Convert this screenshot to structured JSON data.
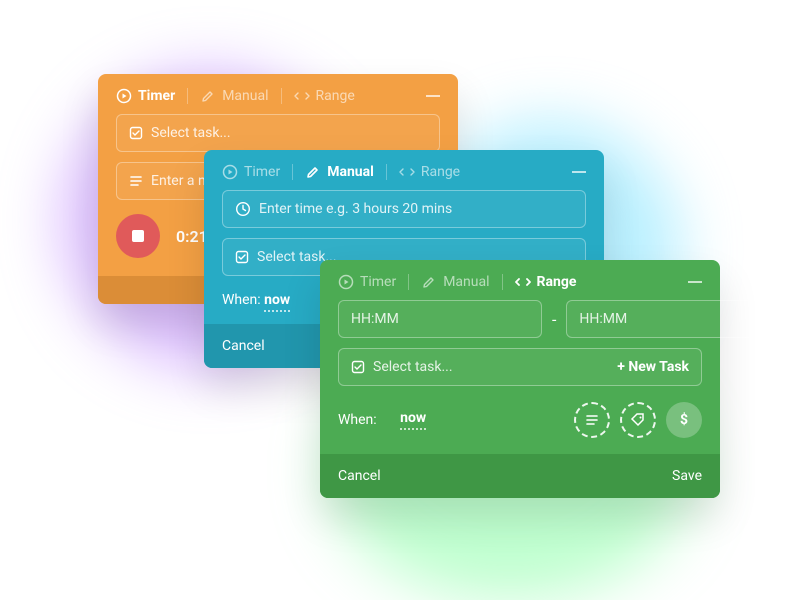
{
  "orange": {
    "tabs": {
      "timer": "Timer",
      "manual": "Manual",
      "range": "Range"
    },
    "select_task_placeholder": "Select task...",
    "note_placeholder": "Enter a note...",
    "elapsed": "0:21:00"
  },
  "teal": {
    "tabs": {
      "timer": "Timer",
      "manual": "Manual",
      "range": "Range"
    },
    "time_placeholder": "Enter time e.g. 3 hours 20 mins",
    "select_task_placeholder": "Select task...",
    "when_label": "When:",
    "when_value": "now",
    "cancel": "Cancel"
  },
  "green": {
    "tabs": {
      "timer": "Timer",
      "manual": "Manual",
      "range": "Range"
    },
    "hhmm": "HH:MM",
    "dash": "-",
    "select_task_placeholder": "Select task...",
    "new_task": "+ New Task",
    "when_label": "When:",
    "when_value": "now",
    "dollar": "$",
    "cancel": "Cancel",
    "save": "Save"
  },
  "colors": {
    "orange": "#f3a044",
    "teal": "#27abc5",
    "green": "#4cab53",
    "halo": "#b97cff"
  }
}
